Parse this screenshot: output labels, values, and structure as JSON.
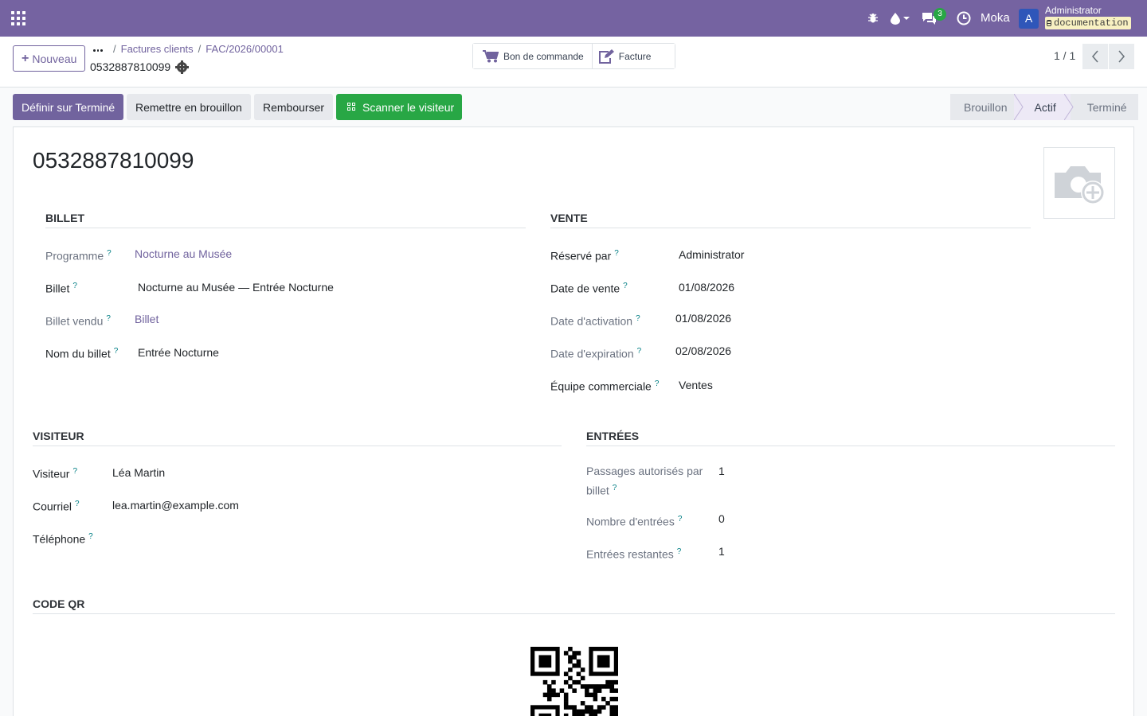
{
  "navbar": {
    "company": "Moka",
    "avatar_letter": "A",
    "user_name": "Administrator",
    "database": "documentation",
    "message_count": "3",
    "icons": [
      "apps-icon",
      "bug-icon",
      "droplet-icon",
      "chat-icon",
      "clock-icon"
    ],
    "color": "#7563a1"
  },
  "control": {
    "new_label": "Nouveau",
    "breadcrumb": [
      "Factures clients",
      "FAC/2026/00001"
    ],
    "record_title": "0532887810099",
    "smart_buttons": [
      {
        "label": "Bon de commande",
        "icon": "cart-icon"
      },
      {
        "label": "Facture",
        "icon": "edit-invoice-icon"
      }
    ],
    "pager": "1 / 1"
  },
  "actions": {
    "set_done": "Définir sur Terminé",
    "reset_draft": "Remettre en brouillon",
    "refund": "Rembourser",
    "scan": "Scanner le visiteur"
  },
  "stages": [
    "Brouillon",
    "Actif",
    "Terminé"
  ],
  "active_stage": "Actif",
  "record": {
    "name": "0532887810099",
    "billet": {
      "title": "BILLET",
      "fields": [
        {
          "label": "Programme",
          "value": "Nocturne au Musée"
        },
        {
          "label": "Billet",
          "value": "Nocturne au Musée — Entrée Nocturne"
        },
        {
          "label": "Billet vendu",
          "value": "Billet"
        },
        {
          "label": "Nom du billet",
          "value": "Entrée Nocturne"
        }
      ]
    },
    "vente": {
      "title": "VENTE",
      "fields": [
        {
          "label": "Réservé par",
          "value": "Administrator"
        },
        {
          "label": "Date de vente",
          "value": "01/08/2026"
        },
        {
          "label": "Date d'activation",
          "value": "01/08/2026"
        },
        {
          "label": "Date d'expiration",
          "value": "02/08/2026"
        },
        {
          "label": "Équipe commerciale",
          "value": "Ventes"
        }
      ]
    },
    "visiteur": {
      "title": "VISITEUR",
      "fields": [
        {
          "label": "Visiteur",
          "value": "Léa Martin"
        },
        {
          "label": "Courriel",
          "value": "lea.martin@example.com"
        },
        {
          "label": "Téléphone",
          "value": ""
        }
      ]
    },
    "entrees": {
      "title": "ENTRÉES",
      "fields": [
        {
          "label": "Passages autorisés par billet",
          "value": "1"
        },
        {
          "label": "Nombre d'entrées",
          "value": "0"
        },
        {
          "label": "Entrées restantes",
          "value": "1"
        }
      ]
    },
    "qr": {
      "title": "CODE QR"
    }
  },
  "help_mark": "?"
}
